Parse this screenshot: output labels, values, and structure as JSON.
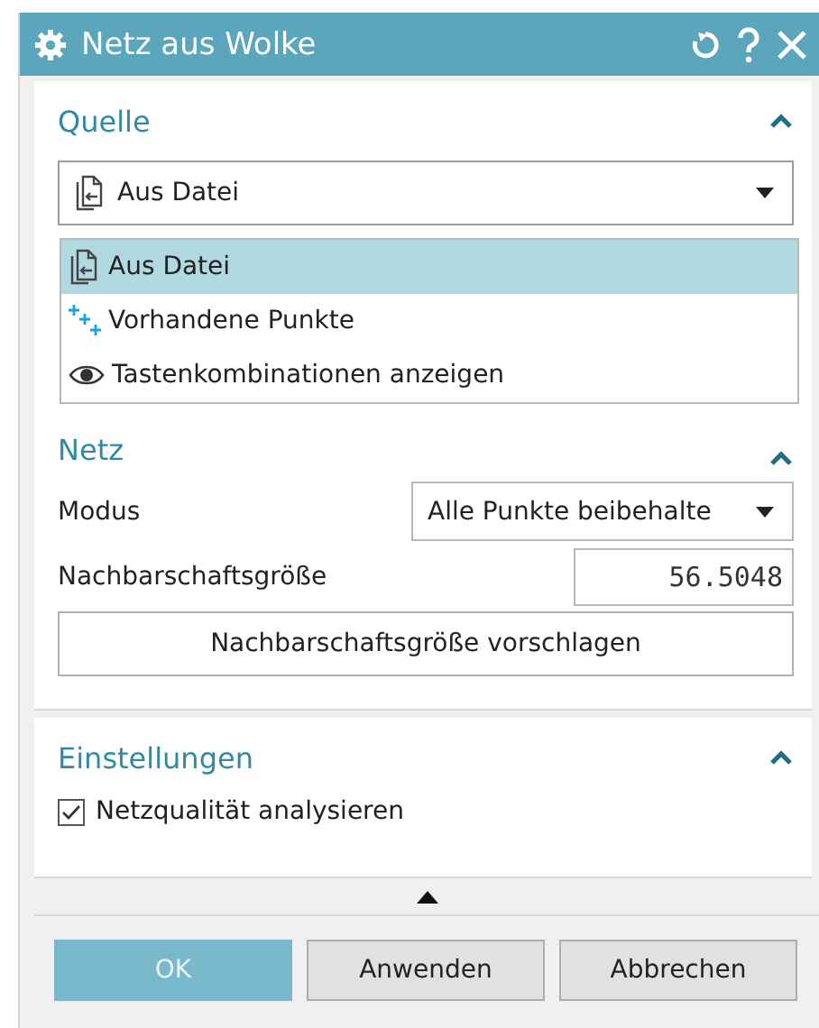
{
  "window": {
    "title": "Netz aus Wolke"
  },
  "source": {
    "title": "Quelle",
    "expanded": true,
    "dropdown": {
      "value": "Aus Datei",
      "open": true
    },
    "options": [
      {
        "label": "Aus Datei",
        "kind": "file",
        "selected": true
      },
      {
        "label": "Vorhandene Punkte",
        "kind": "points",
        "selected": false
      },
      {
        "label": "Tastenkombinationen anzeigen",
        "kind": "eye",
        "selected": false
      }
    ]
  },
  "mesh": {
    "title": "Netz",
    "expanded": true,
    "mode": {
      "label": "Modus",
      "value": "Alle Punkte beibehalte"
    },
    "neighborhood": {
      "label": "Nachbarschaftsgröße",
      "value": "56.5048"
    },
    "suggest_button": "Nachbarschaftsgröße vorschlagen"
  },
  "settings": {
    "title": "Einstellungen",
    "expanded": true,
    "checkbox": {
      "label": "Netzqualität analysieren",
      "checked": true
    }
  },
  "buttons": [
    {
      "label": "OK",
      "kind": "primary"
    },
    {
      "label": "Anwenden",
      "kind": "normal"
    },
    {
      "label": "Abbrechen",
      "kind": "normal"
    }
  ]
}
